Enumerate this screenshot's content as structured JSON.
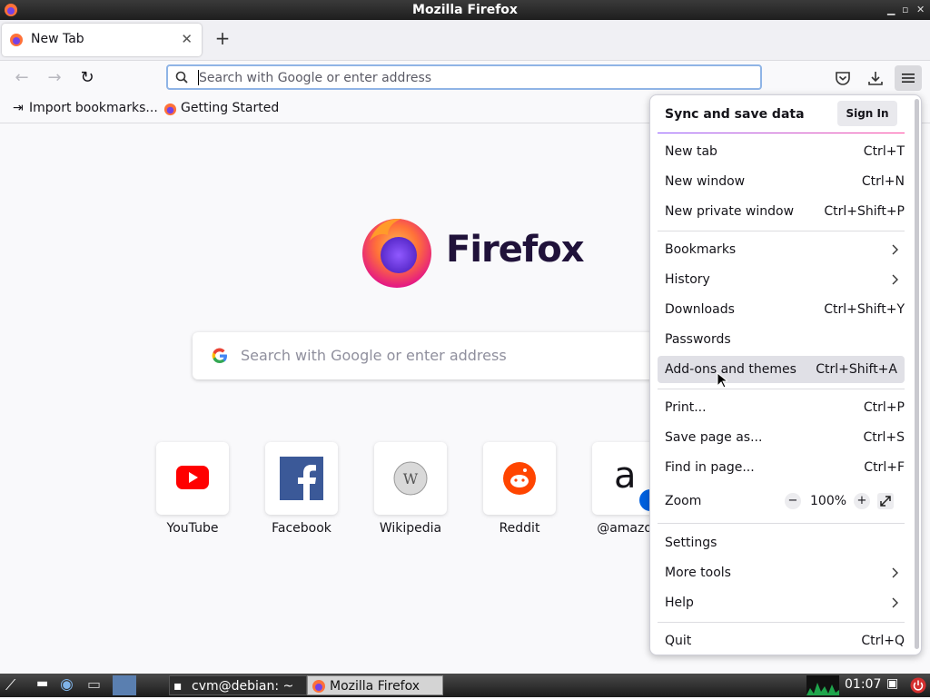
{
  "window": {
    "title": "Mozilla Firefox"
  },
  "tabs": [
    {
      "label": "New Tab"
    }
  ],
  "urlbar": {
    "placeholder": "Search with Google or enter address"
  },
  "bookmarks": [
    {
      "label": "Import bookmarks..."
    },
    {
      "label": "Getting Started"
    }
  ],
  "content": {
    "wordmark": "Firefox",
    "search_placeholder": "Search with Google or enter address",
    "top_sites": [
      {
        "label": "YouTube",
        "icon": "youtube-icon"
      },
      {
        "label": "Facebook",
        "icon": "facebook-icon"
      },
      {
        "label": "Wikipedia",
        "icon": "wikipedia-icon"
      },
      {
        "label": "Reddit",
        "icon": "reddit-icon"
      },
      {
        "label": "@amazon",
        "icon": "amazon-icon"
      }
    ]
  },
  "menu": {
    "sync_title": "Sync and save data",
    "sign_in": "Sign In",
    "items": [
      {
        "label": "New tab",
        "shortcut": "Ctrl+T"
      },
      {
        "label": "New window",
        "shortcut": "Ctrl+N"
      },
      {
        "label": "New private window",
        "shortcut": "Ctrl+Shift+P"
      },
      {
        "label": "Bookmarks",
        "shortcut": ""
      },
      {
        "label": "History",
        "shortcut": ""
      },
      {
        "label": "Downloads",
        "shortcut": "Ctrl+Shift+Y"
      },
      {
        "label": "Passwords",
        "shortcut": ""
      },
      {
        "label": "Add-ons and themes",
        "shortcut": "Ctrl+Shift+A"
      },
      {
        "label": "Print...",
        "shortcut": "Ctrl+P"
      },
      {
        "label": "Save page as...",
        "shortcut": "Ctrl+S"
      },
      {
        "label": "Find in page...",
        "shortcut": "Ctrl+F"
      },
      {
        "label": "Zoom",
        "shortcut": ""
      },
      {
        "label": "Settings",
        "shortcut": ""
      },
      {
        "label": "More tools",
        "shortcut": ""
      },
      {
        "label": "Help",
        "shortcut": ""
      },
      {
        "label": "Quit",
        "shortcut": "Ctrl+Q"
      }
    ],
    "zoom_minus": "−",
    "zoom_value": "100%",
    "zoom_plus": "+"
  },
  "taskbar": {
    "tasks": [
      {
        "label": "cvm@debian: ~"
      },
      {
        "label": "Mozilla Firefox"
      }
    ],
    "clock": "01:07"
  },
  "colors": {
    "accent": "#0060df",
    "hover": "#e0e0e6",
    "taskbar": "#1b1b1b"
  }
}
